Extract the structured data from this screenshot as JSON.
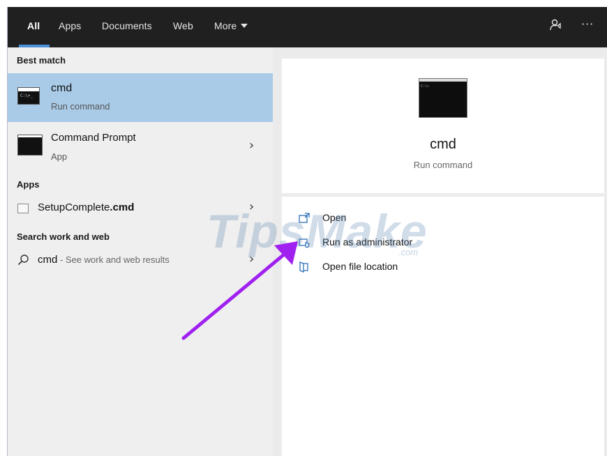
{
  "tabs": [
    {
      "label": "All",
      "active": true
    },
    {
      "label": "Apps"
    },
    {
      "label": "Documents"
    },
    {
      "label": "Web"
    },
    {
      "label": "More"
    }
  ],
  "toolbar_icons": [
    "feedback-icon",
    "more-options-icon"
  ],
  "results": {
    "best_match_label": "Best match",
    "best": {
      "title": "cmd",
      "subtitle": "Run command"
    },
    "second": {
      "title": "Command Prompt",
      "subtitle": "App"
    },
    "apps_label": "Apps",
    "app_item": {
      "name_prefix": "SetupComplete",
      "name_ext": ".cmd"
    },
    "web_label": "Search work and web",
    "web_item": {
      "query": "cmd",
      "hint": " - See work and web results"
    }
  },
  "detail": {
    "title": "cmd",
    "subtitle": "Run command",
    "actions": [
      {
        "label": "Open",
        "icon": "open-icon"
      },
      {
        "label": "Run as administrator",
        "icon": "shield-icon"
      },
      {
        "label": "Open file location",
        "icon": "folder-icon"
      }
    ]
  },
  "watermark": {
    "main": "TipsMake",
    "suffix": ".com"
  },
  "colors": {
    "topbar": "#202020",
    "selected": "#a9cbe8",
    "accent": "#4a90d9",
    "arrow": "#a020f0"
  }
}
